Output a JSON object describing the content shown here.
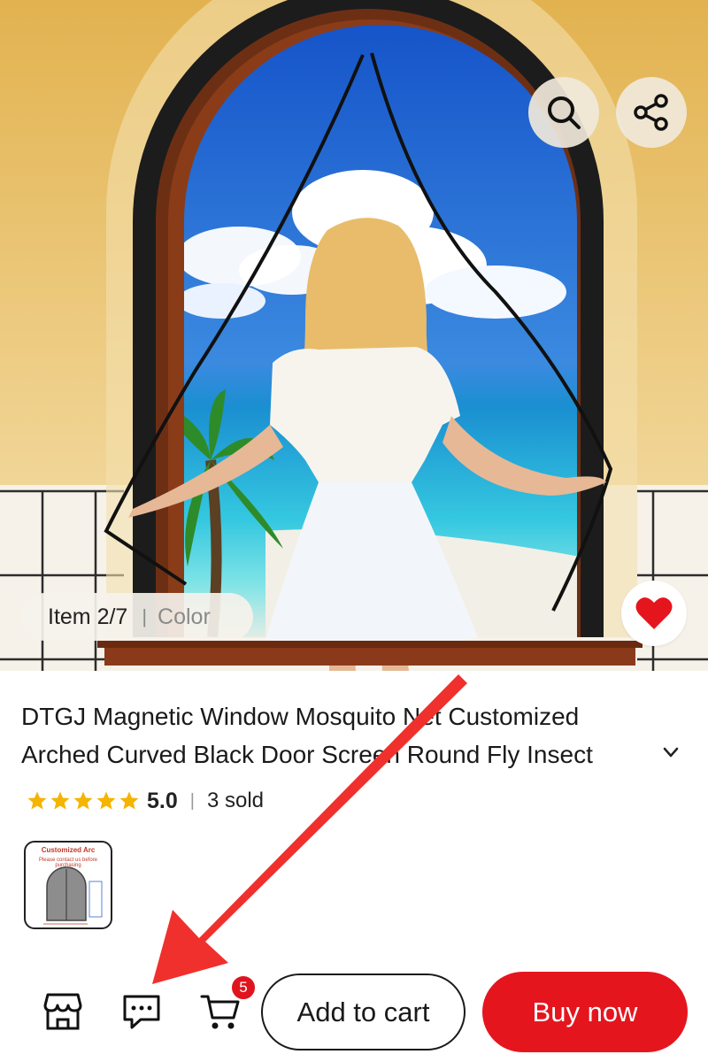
{
  "hero": {
    "item_label": "Item 2/7",
    "item_separator": "|",
    "variant_label": "Color"
  },
  "product": {
    "title_line1": "DTGJ Magnetic Window Mosquito Net Customized",
    "title_line2": "Arched Curved Black Door Screen Round Fly Insect",
    "rating_value": "5.0",
    "rating_separator": "|",
    "sold_text": "3 sold",
    "stars": 5
  },
  "thumbnail": {
    "title": "Customized Arc",
    "subtitle": "Please contact us before purchasing"
  },
  "bottom_bar": {
    "cart_count": "5",
    "add_to_cart_label": "Add to cart",
    "buy_now_label": "Buy now"
  },
  "colors": {
    "accent_red": "#e5151e",
    "badge_red": "#e0141e",
    "star_yellow": "#f5b400",
    "annotation_arrow": "#f0302c"
  },
  "icons": {
    "search": "search-icon",
    "share": "share-icon",
    "favorite": "heart-icon",
    "expand": "chevron-down-icon",
    "store": "store-icon",
    "chat": "chat-icon",
    "cart": "cart-icon"
  }
}
